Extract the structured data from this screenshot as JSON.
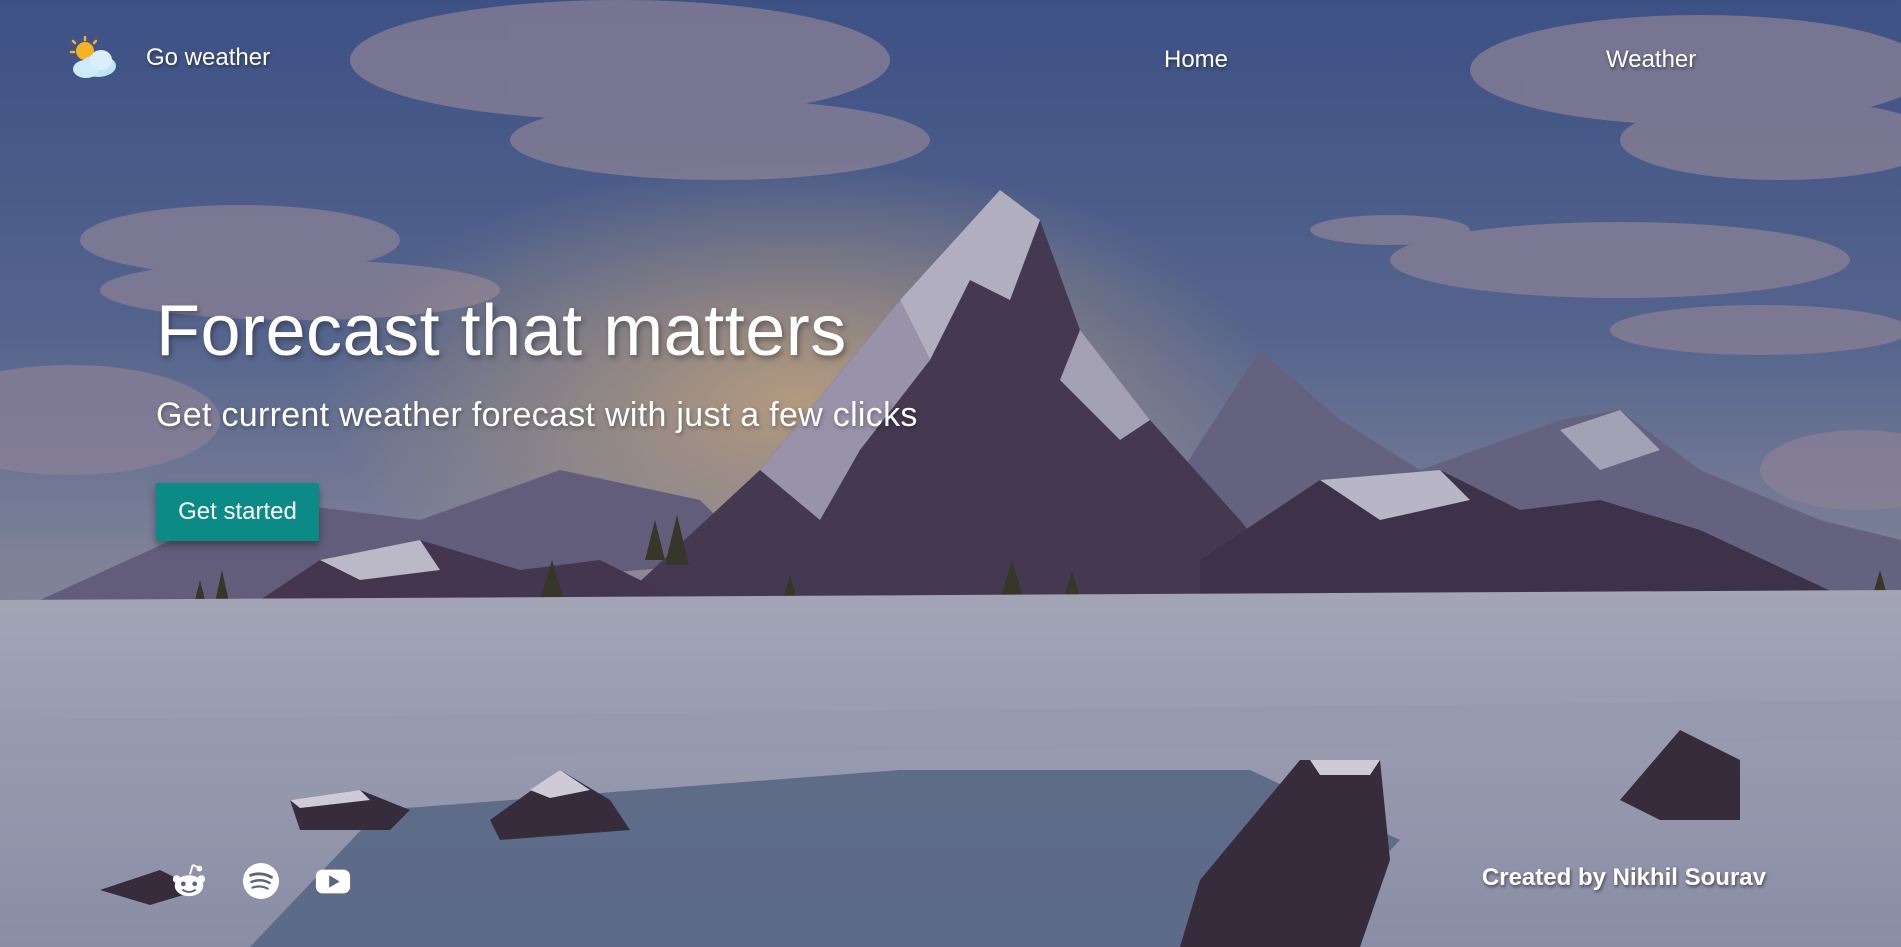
{
  "nav": {
    "brand_text": "Go weather",
    "brand_icon": "sun-cloud-icon",
    "links": [
      {
        "label": "Home"
      },
      {
        "label": "Weather"
      }
    ]
  },
  "hero": {
    "title": "Forecast that matters",
    "subtitle": "Get current weather forecast with just a few clicks",
    "cta_label": "Get started"
  },
  "footer": {
    "social_icons": [
      "reddit-icon",
      "spotify-icon",
      "youtube-icon"
    ],
    "credit": "Created by Nikhil Sourav"
  },
  "colors": {
    "accent": "#0b8a86",
    "sky": "#465b8c",
    "text": "#ffffff"
  }
}
